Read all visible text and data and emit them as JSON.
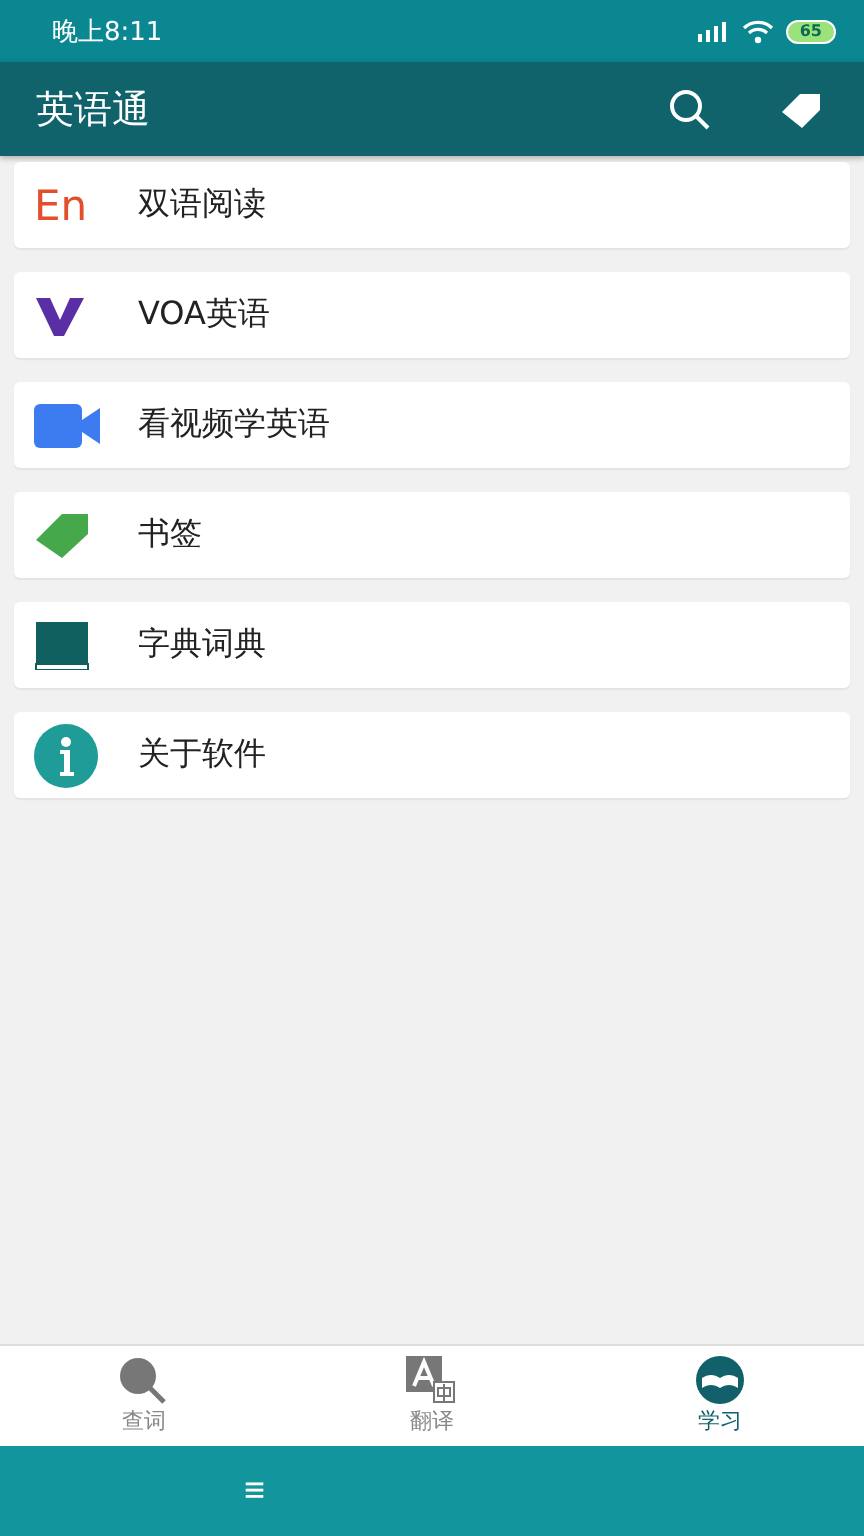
{
  "status_bar": {
    "time": "晚上8:11",
    "battery": "65"
  },
  "app_bar": {
    "title": "英语通"
  },
  "menu": [
    {
      "kind": "en",
      "icon_text": "En",
      "label": "双语阅读"
    },
    {
      "kind": "voa",
      "label": "VOA英语"
    },
    {
      "kind": "video",
      "label": "看视频学英语"
    },
    {
      "kind": "tag",
      "label": "书签"
    },
    {
      "kind": "book",
      "label": "字典词典"
    },
    {
      "kind": "info",
      "label": "关于软件"
    }
  ],
  "bottom_nav": [
    {
      "kind": "lookup",
      "label": "查词",
      "selected": false
    },
    {
      "kind": "translate",
      "label": "翻译",
      "selected": false
    },
    {
      "kind": "study",
      "label": "学习",
      "selected": true
    }
  ],
  "system_nav": {
    "menu_glyph": "≡"
  }
}
